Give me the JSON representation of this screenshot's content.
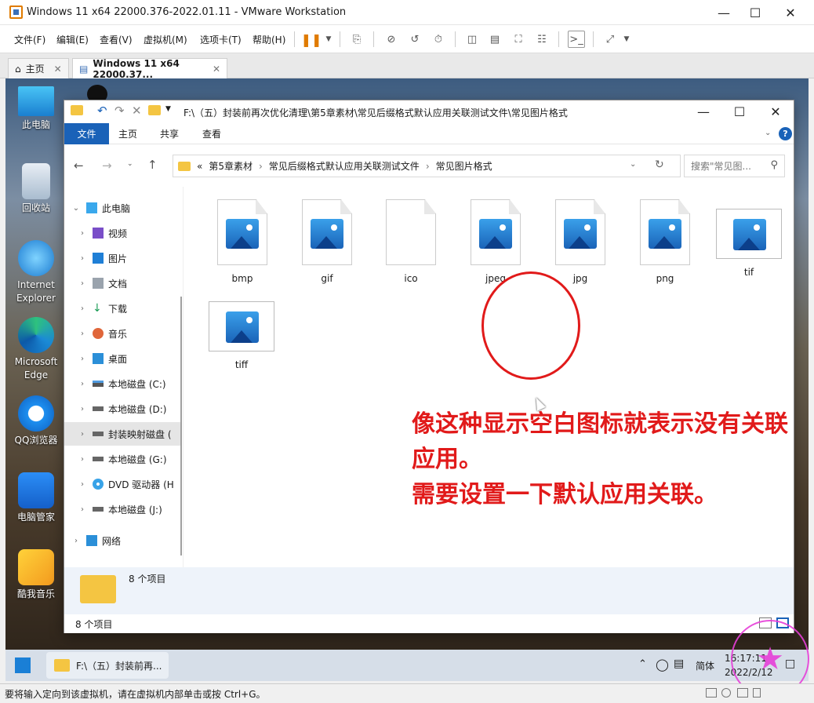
{
  "vmware": {
    "title": "Windows 11 x64 22000.376-2022.01.11 - VMware Workstation",
    "menu": [
      "文件(F)",
      "编辑(E)",
      "查看(V)",
      "虚拟机(M)",
      "选项卡(T)",
      "帮助(H)"
    ],
    "tabs": [
      {
        "label": "主页"
      },
      {
        "label": "Windows 11 x64 22000.37..."
      }
    ],
    "status_hint": "要将输入定向到该虚拟机，请在虚拟机内部单击或按 Ctrl+G。"
  },
  "desktop_icons": [
    {
      "label": "此电脑",
      "icon": "monitor-icon"
    },
    {
      "label": "回收站",
      "icon": "recycle-bin-icon"
    },
    {
      "label": "Internet Explorer",
      "icon": "ie-icon"
    },
    {
      "label": "Microsoft Edge",
      "icon": "edge-icon"
    },
    {
      "label": "QQ浏览器",
      "icon": "qq-browser-icon"
    },
    {
      "label": "电脑管家",
      "icon": "pc-manager-icon"
    },
    {
      "label": "酷我音乐",
      "icon": "kuwo-icon"
    }
  ],
  "explorer": {
    "title_path": "F:\\（五）封装前再次优化清理\\第5章素材\\常见后缀格式默认应用关联测试文件\\常见图片格式",
    "ribbon_tabs": [
      "文件",
      "主页",
      "共享",
      "查看"
    ],
    "breadcrumb": [
      "«",
      "第5章素材",
      "常见后缀格式默认应用关联测试文件",
      "常见图片格式"
    ],
    "search_placeholder": "搜索\"常见图...",
    "nav": [
      {
        "label": "此电脑",
        "level": 0,
        "expanded": true
      },
      {
        "label": "视频",
        "level": 1
      },
      {
        "label": "图片",
        "level": 1
      },
      {
        "label": "文档",
        "level": 1
      },
      {
        "label": "下载",
        "level": 1
      },
      {
        "label": "音乐",
        "level": 1
      },
      {
        "label": "桌面",
        "level": 1
      },
      {
        "label": "本地磁盘 (C:)",
        "level": 1
      },
      {
        "label": "本地磁盘 (D:)",
        "level": 1
      },
      {
        "label": "封装映射磁盘 (",
        "level": 1,
        "selected": true
      },
      {
        "label": "本地磁盘 (G:)",
        "level": 1
      },
      {
        "label": "DVD 驱动器 (H",
        "level": 1
      },
      {
        "label": "本地磁盘 (J:)",
        "level": 1
      },
      {
        "label": "网络",
        "level": 0
      }
    ],
    "files": [
      {
        "name": "bmp",
        "kind": "image"
      },
      {
        "name": "gif",
        "kind": "image"
      },
      {
        "name": "ico",
        "kind": "blank"
      },
      {
        "name": "jpeg",
        "kind": "image"
      },
      {
        "name": "jpg",
        "kind": "image"
      },
      {
        "name": "png",
        "kind": "image"
      },
      {
        "name": "tif",
        "kind": "photo"
      },
      {
        "name": "tiff",
        "kind": "photo"
      }
    ],
    "annotation_line1": "像这种显示空白图标就表示没有关联应用。",
    "annotation_line2": "需要设置一下默认应用关联。",
    "details_count": "8 个项目",
    "status_count": "8 个项目"
  },
  "taskbar": {
    "task_label": "F:\\（五）封装前再...",
    "ime": "简体",
    "time": "16:17:11",
    "date": "2022/2/12"
  },
  "colors": {
    "accent": "#1a62b8",
    "annotation": "#e11a1a",
    "pause": "#e07b00"
  }
}
